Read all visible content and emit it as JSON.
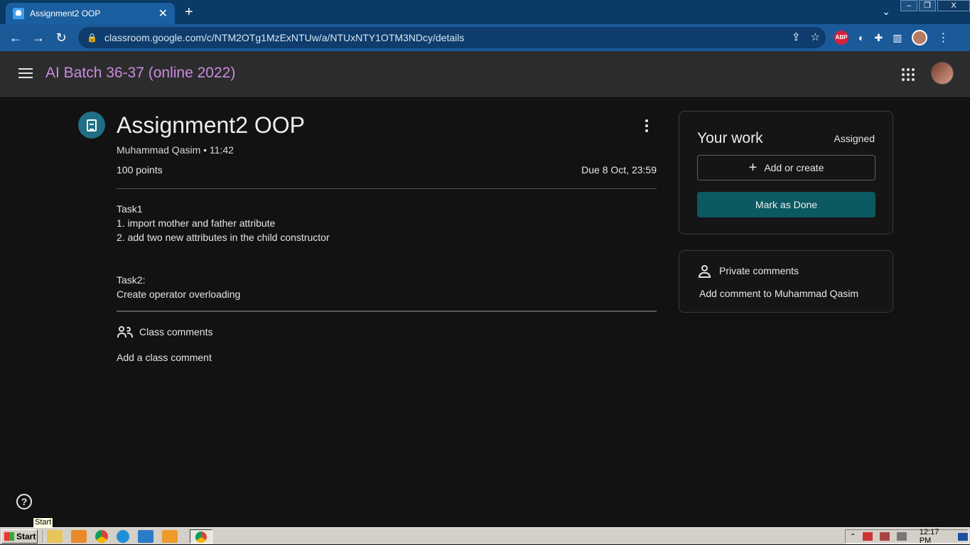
{
  "browser": {
    "tab_title": "Assignment2 OOP",
    "tab_close": "✕",
    "new_tab": "+",
    "url": "classroom.google.com/c/NTM2OTg1MzExNTUw/a/NTUxNTY1OTM3NDcy/details",
    "win_controls": {
      "minimize": "–",
      "restore": "❐",
      "close": "X"
    },
    "extensions": {
      "abp": "ABP"
    }
  },
  "header": {
    "class_name": "AI Batch 36-37 (online 2022)"
  },
  "assignment": {
    "title": "Assignment2 OOP",
    "author_line": "Muhammad Qasim • 11:42",
    "points": "100 points",
    "due": "Due 8 Oct, 23:59",
    "description": {
      "task1_title": "Task1",
      "task1_line1": "1. import mother and father attribute",
      "task1_line2": "2. add two new attributes in the child constructor",
      "task2_title": "Task2:",
      "task2_line1": "Create operator overloading"
    }
  },
  "comments": {
    "class_comments_label": "Class comments",
    "add_class_comment": "Add a class comment"
  },
  "your_work": {
    "title": "Your work",
    "status": "Assigned",
    "add_or_create": "Add or create",
    "mark_as_done": "Mark as Done"
  },
  "private_comments": {
    "label": "Private comments",
    "add": "Add comment to Muhammad Qasim"
  },
  "help": {
    "label": "?"
  },
  "taskbar": {
    "tooltip": "Start",
    "start_label": "Start",
    "clock": "12:17 PM"
  },
  "colors": {
    "accent_class_name": "#c98bdf",
    "mark_done_bg": "#0b5962",
    "assignment_icon_bg": "#1f6f86"
  }
}
